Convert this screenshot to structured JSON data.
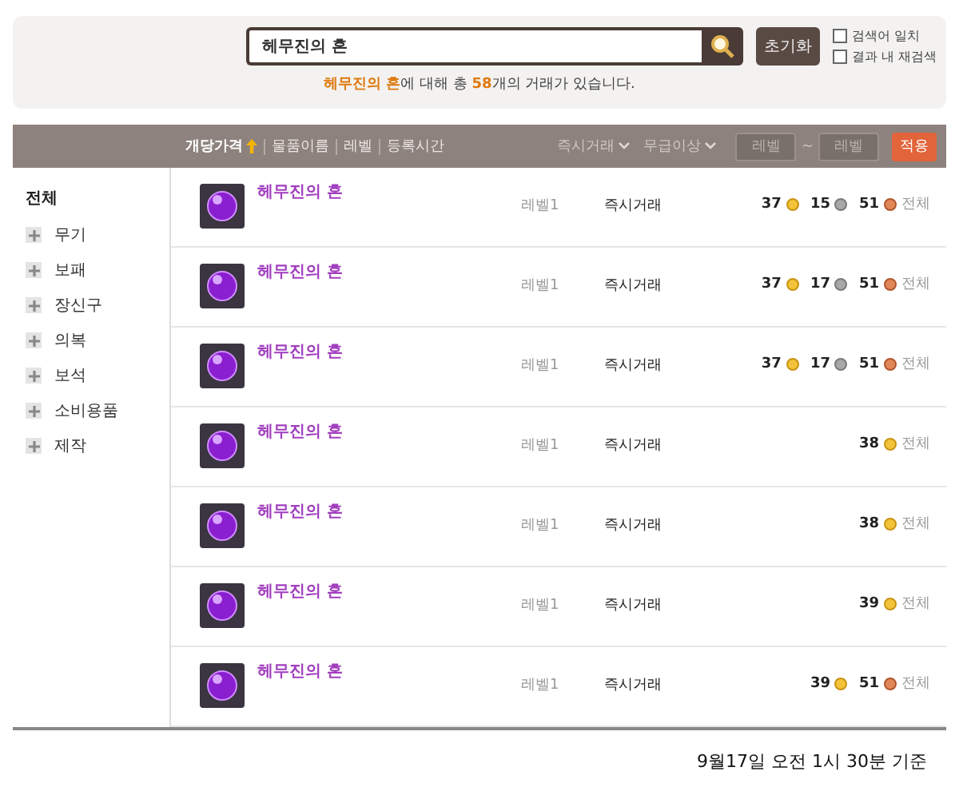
{
  "search": {
    "value": "헤무진의 혼",
    "reset": "초기화",
    "options": [
      {
        "label": "검색어 일치",
        "checked": false
      },
      {
        "label": "결과 내 재검색",
        "checked": false
      }
    ],
    "summary": "**헤무진의 혼**에 대해 총 **58**개의 거래가 있습니다."
  },
  "toolbar": {
    "sorts": [
      {
        "label": "개당가격",
        "selected": true
      },
      {
        "label": "물품이름",
        "selected": false
      },
      {
        "label": "레벨",
        "selected": false
      },
      {
        "label": "등록시간",
        "selected": false
      }
    ],
    "dropdowns": [
      "즉시거래",
      "무급이상"
    ],
    "level_min": {
      "placeholder": "레벨"
    },
    "separator": "~",
    "level_max": {
      "placeholder": "레벨"
    },
    "apply": "적용"
  },
  "sidebar": {
    "title": "전체",
    "items": [
      {
        "label": "무기",
        "expanded": false
      },
      {
        "label": "보패",
        "expanded": false
      },
      {
        "label": "장신구",
        "expanded": false
      },
      {
        "label": "의복",
        "expanded": false
      },
      {
        "label": "보석",
        "expanded": false
      },
      {
        "label": "소비용품",
        "expanded": false
      },
      {
        "label": "제작",
        "expanded": false
      }
    ]
  },
  "rows": [
    {
      "name": "헤무진의 혼",
      "level": "레벨1",
      "trade": "즉시거래",
      "price": [
        {
          "amount": "37",
          "kind": "gold"
        },
        {
          "amount": "15",
          "kind": "silver"
        },
        {
          "amount": "51",
          "kind": "copper"
        }
      ],
      "scope": "전체"
    },
    {
      "name": "헤무진의 혼",
      "level": "레벨1",
      "trade": "즉시거래",
      "price": [
        {
          "amount": "37",
          "kind": "gold"
        },
        {
          "amount": "17",
          "kind": "silver"
        },
        {
          "amount": "51",
          "kind": "copper"
        }
      ],
      "scope": "전체"
    },
    {
      "name": "헤무진의 혼",
      "level": "레벨1",
      "trade": "즉시거래",
      "price": [
        {
          "amount": "37",
          "kind": "gold"
        },
        {
          "amount": "17",
          "kind": "silver"
        },
        {
          "amount": "51",
          "kind": "copper"
        }
      ],
      "scope": "전체"
    },
    {
      "name": "헤무진의 혼",
      "level": "레벨1",
      "trade": "즉시거래",
      "price": [
        {
          "amount": "38",
          "kind": "gold"
        }
      ],
      "scope": "전체"
    },
    {
      "name": "헤무진의 혼",
      "level": "레벨1",
      "trade": "즉시거래",
      "price": [
        {
          "amount": "38",
          "kind": "gold"
        }
      ],
      "scope": "전체"
    },
    {
      "name": "헤무진의 혼",
      "level": "레벨1",
      "trade": "즉시거래",
      "price": [
        {
          "amount": "39",
          "kind": "gold"
        }
      ],
      "scope": "전체"
    },
    {
      "name": "헤무진의 혼",
      "level": "레벨1",
      "trade": "즉시거래",
      "price": [
        {
          "amount": "39",
          "kind": "gold"
        },
        {
          "amount": "51",
          "kind": "copper"
        }
      ],
      "scope": "전체"
    }
  ],
  "footer": {
    "timestamp": "9월17일 오전 1시 30분 기준"
  }
}
